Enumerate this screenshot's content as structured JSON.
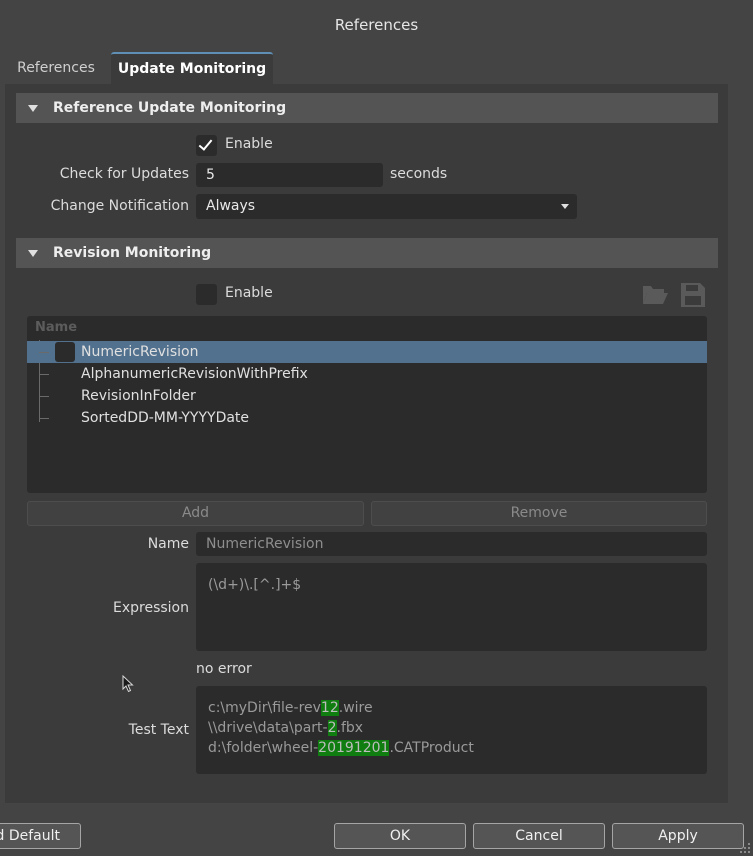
{
  "window": {
    "title": "References"
  },
  "tabs": [
    {
      "label": "References",
      "active": false
    },
    {
      "label": "Update Monitoring",
      "active": true
    }
  ],
  "reference_update": {
    "header": "Reference Update Monitoring",
    "enable_label": "Enable",
    "enable_checked": true,
    "check_label": "Check for Updates",
    "check_value": "5",
    "check_unit": "seconds",
    "notification_label": "Change Notification",
    "notification_value": "Always"
  },
  "revision": {
    "header": "Revision Monitoring",
    "enable_label": "Enable",
    "enable_checked": false,
    "icons": [
      "folder-open-icon",
      "save-icon"
    ],
    "list_header": "Name",
    "items": [
      {
        "label": "NumericRevision",
        "selected": true
      },
      {
        "label": "AlphanumericRevisionWithPrefix",
        "selected": false
      },
      {
        "label": "RevisionInFolder",
        "selected": false
      },
      {
        "label": "SortedDD-MM-YYYYDate",
        "selected": false
      }
    ],
    "add_label": "Add",
    "remove_label": "Remove",
    "name_label": "Name",
    "name_value": "NumericRevision",
    "expression_label": "Expression",
    "expression_value": "(\\d+)\\.[^.]+$",
    "error_text": "no error",
    "test_label": "Test Text",
    "test_lines": [
      {
        "pre": "c:\\myDir\\file-rev",
        "match": "12",
        "post": ".wire"
      },
      {
        "pre": "\\\\drive\\data\\part-",
        "match": "2",
        "post": ".fbx"
      },
      {
        "pre": "d:\\folder\\wheel-",
        "match": "20191201",
        "post": ".CATProduct"
      }
    ]
  },
  "footer": {
    "default_label": "d Default",
    "ok_label": "OK",
    "cancel_label": "Cancel",
    "apply_label": "Apply"
  },
  "colors": {
    "selection": "#52718e",
    "match_highlight": "#0f7d0f",
    "tab_accent": "#5f8fb5"
  }
}
